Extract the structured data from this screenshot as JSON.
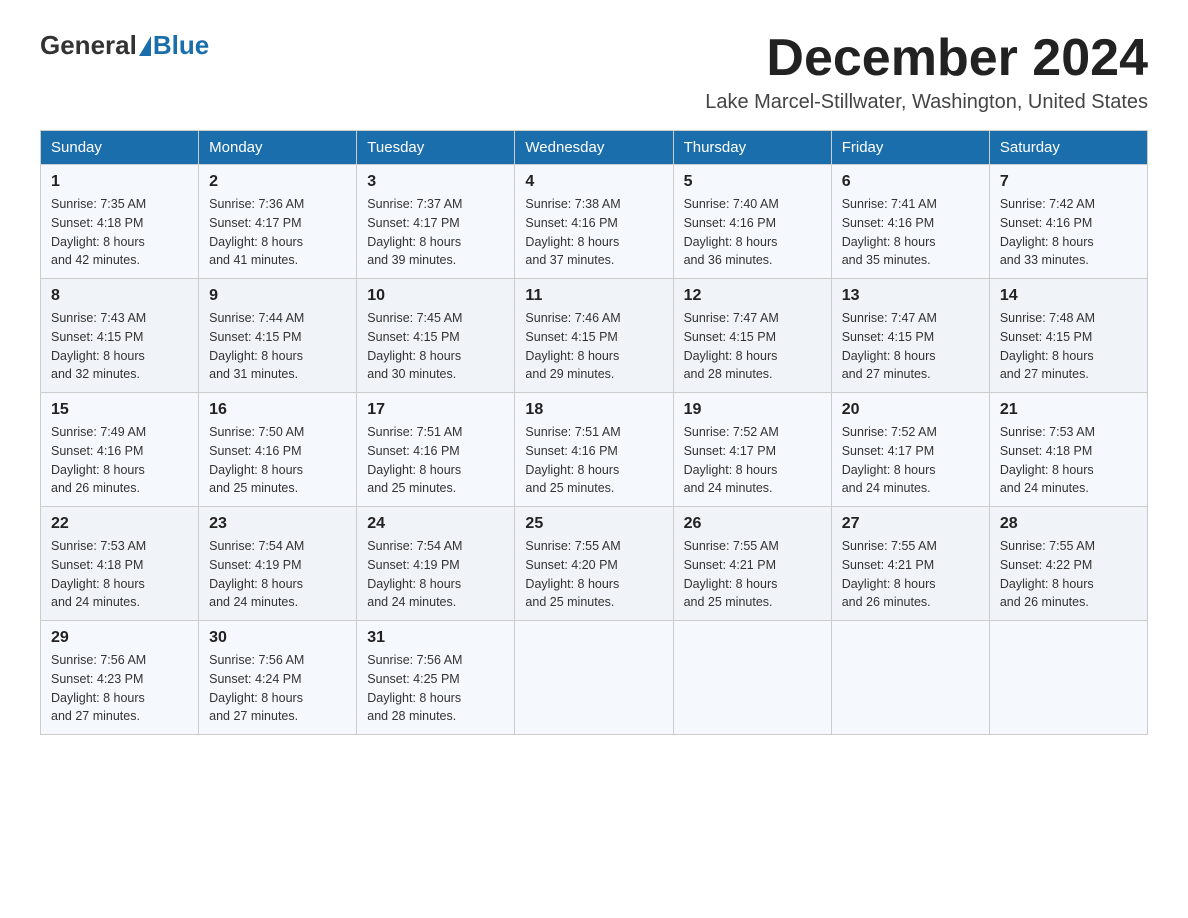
{
  "header": {
    "logo_general": "General",
    "logo_blue": "Blue",
    "month_title": "December 2024",
    "location": "Lake Marcel-Stillwater, Washington, United States"
  },
  "days_of_week": [
    "Sunday",
    "Monday",
    "Tuesday",
    "Wednesday",
    "Thursday",
    "Friday",
    "Saturday"
  ],
  "weeks": [
    [
      {
        "day": "1",
        "sunrise": "7:35 AM",
        "sunset": "4:18 PM",
        "daylight": "8 hours and 42 minutes."
      },
      {
        "day": "2",
        "sunrise": "7:36 AM",
        "sunset": "4:17 PM",
        "daylight": "8 hours and 41 minutes."
      },
      {
        "day": "3",
        "sunrise": "7:37 AM",
        "sunset": "4:17 PM",
        "daylight": "8 hours and 39 minutes."
      },
      {
        "day": "4",
        "sunrise": "7:38 AM",
        "sunset": "4:16 PM",
        "daylight": "8 hours and 37 minutes."
      },
      {
        "day": "5",
        "sunrise": "7:40 AM",
        "sunset": "4:16 PM",
        "daylight": "8 hours and 36 minutes."
      },
      {
        "day": "6",
        "sunrise": "7:41 AM",
        "sunset": "4:16 PM",
        "daylight": "8 hours and 35 minutes."
      },
      {
        "day": "7",
        "sunrise": "7:42 AM",
        "sunset": "4:16 PM",
        "daylight": "8 hours and 33 minutes."
      }
    ],
    [
      {
        "day": "8",
        "sunrise": "7:43 AM",
        "sunset": "4:15 PM",
        "daylight": "8 hours and 32 minutes."
      },
      {
        "day": "9",
        "sunrise": "7:44 AM",
        "sunset": "4:15 PM",
        "daylight": "8 hours and 31 minutes."
      },
      {
        "day": "10",
        "sunrise": "7:45 AM",
        "sunset": "4:15 PM",
        "daylight": "8 hours and 30 minutes."
      },
      {
        "day": "11",
        "sunrise": "7:46 AM",
        "sunset": "4:15 PM",
        "daylight": "8 hours and 29 minutes."
      },
      {
        "day": "12",
        "sunrise": "7:47 AM",
        "sunset": "4:15 PM",
        "daylight": "8 hours and 28 minutes."
      },
      {
        "day": "13",
        "sunrise": "7:47 AM",
        "sunset": "4:15 PM",
        "daylight": "8 hours and 27 minutes."
      },
      {
        "day": "14",
        "sunrise": "7:48 AM",
        "sunset": "4:15 PM",
        "daylight": "8 hours and 27 minutes."
      }
    ],
    [
      {
        "day": "15",
        "sunrise": "7:49 AM",
        "sunset": "4:16 PM",
        "daylight": "8 hours and 26 minutes."
      },
      {
        "day": "16",
        "sunrise": "7:50 AM",
        "sunset": "4:16 PM",
        "daylight": "8 hours and 25 minutes."
      },
      {
        "day": "17",
        "sunrise": "7:51 AM",
        "sunset": "4:16 PM",
        "daylight": "8 hours and 25 minutes."
      },
      {
        "day": "18",
        "sunrise": "7:51 AM",
        "sunset": "4:16 PM",
        "daylight": "8 hours and 25 minutes."
      },
      {
        "day": "19",
        "sunrise": "7:52 AM",
        "sunset": "4:17 PM",
        "daylight": "8 hours and 24 minutes."
      },
      {
        "day": "20",
        "sunrise": "7:52 AM",
        "sunset": "4:17 PM",
        "daylight": "8 hours and 24 minutes."
      },
      {
        "day": "21",
        "sunrise": "7:53 AM",
        "sunset": "4:18 PM",
        "daylight": "8 hours and 24 minutes."
      }
    ],
    [
      {
        "day": "22",
        "sunrise": "7:53 AM",
        "sunset": "4:18 PM",
        "daylight": "8 hours and 24 minutes."
      },
      {
        "day": "23",
        "sunrise": "7:54 AM",
        "sunset": "4:19 PM",
        "daylight": "8 hours and 24 minutes."
      },
      {
        "day": "24",
        "sunrise": "7:54 AM",
        "sunset": "4:19 PM",
        "daylight": "8 hours and 24 minutes."
      },
      {
        "day": "25",
        "sunrise": "7:55 AM",
        "sunset": "4:20 PM",
        "daylight": "8 hours and 25 minutes."
      },
      {
        "day": "26",
        "sunrise": "7:55 AM",
        "sunset": "4:21 PM",
        "daylight": "8 hours and 25 minutes."
      },
      {
        "day": "27",
        "sunrise": "7:55 AM",
        "sunset": "4:21 PM",
        "daylight": "8 hours and 26 minutes."
      },
      {
        "day": "28",
        "sunrise": "7:55 AM",
        "sunset": "4:22 PM",
        "daylight": "8 hours and 26 minutes."
      }
    ],
    [
      {
        "day": "29",
        "sunrise": "7:56 AM",
        "sunset": "4:23 PM",
        "daylight": "8 hours and 27 minutes."
      },
      {
        "day": "30",
        "sunrise": "7:56 AM",
        "sunset": "4:24 PM",
        "daylight": "8 hours and 27 minutes."
      },
      {
        "day": "31",
        "sunrise": "7:56 AM",
        "sunset": "4:25 PM",
        "daylight": "8 hours and 28 minutes."
      },
      null,
      null,
      null,
      null
    ]
  ],
  "labels": {
    "sunrise": "Sunrise:",
    "sunset": "Sunset:",
    "daylight": "Daylight:"
  }
}
